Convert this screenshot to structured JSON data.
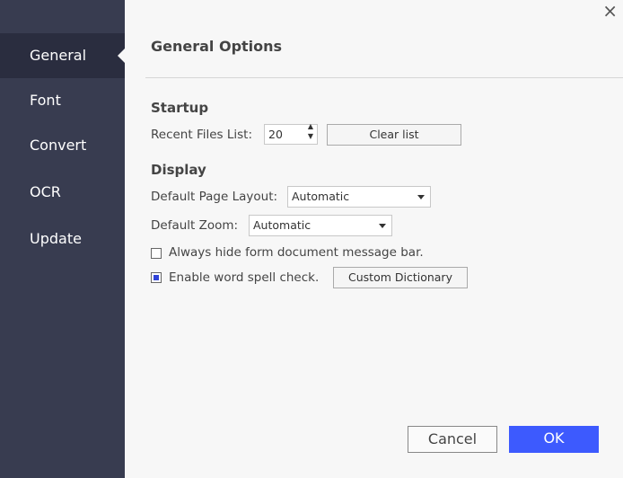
{
  "sidebar": {
    "items": [
      {
        "label": "General",
        "active": true
      },
      {
        "label": "Font"
      },
      {
        "label": "Convert"
      },
      {
        "label": "OCR"
      },
      {
        "label": "Update"
      }
    ]
  },
  "close_icon": "×",
  "title": "General Options",
  "startup": {
    "heading": "Startup",
    "recent_label": "Recent Files List:",
    "recent_value": "20",
    "clear_label": "Clear list"
  },
  "display": {
    "heading": "Display",
    "layout_label": "Default Page Layout:",
    "layout_value": "Automatic",
    "zoom_label": "Default Zoom:",
    "zoom_value": "Automatic",
    "hide_bar_label": "Always hide form document message bar.",
    "hide_bar_checked": false,
    "spell_label": "Enable word spell check.",
    "spell_checked": true,
    "dictionary_label": "Custom Dictionary"
  },
  "footer": {
    "cancel": "Cancel",
    "ok": "OK"
  },
  "colors": {
    "sidebar": "#383c50",
    "active": "#2a2d3f",
    "accent": "#3d5afe"
  }
}
